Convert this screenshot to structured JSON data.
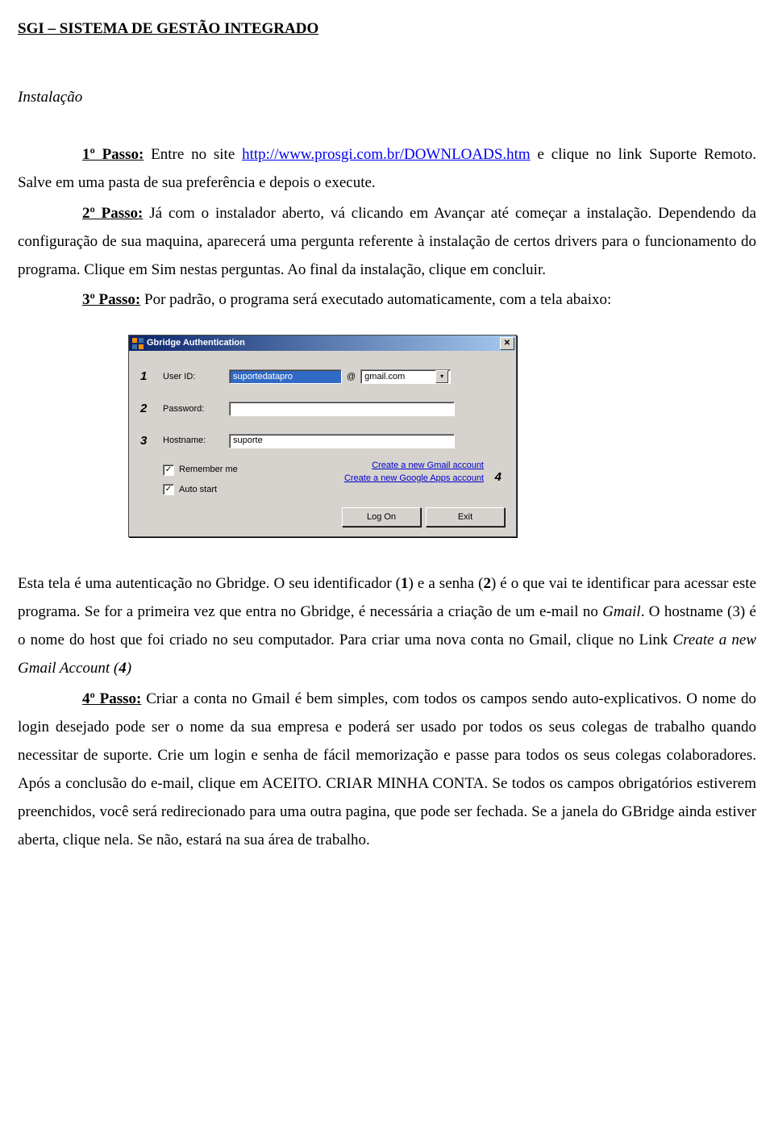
{
  "header": "SGI – SISTEMA DE GESTÃO INTEGRADO",
  "section": "Instalação",
  "step1": {
    "label": "1º Passo:",
    "text_before_link": " Entre no site ",
    "url": "http://www.prosgi.com.br/DOWNLOADS.htm",
    "text_after_link": " e clique no link Suporte Remoto. Salve em uma pasta de sua preferência e depois o execute."
  },
  "step2": {
    "label": "2º Passo:",
    "text": " Já com o instalador aberto, vá clicando em Avançar até começar a instalação. Dependendo da configuração de sua maquina, aparecerá uma pergunta referente à instalação de certos drivers para o funcionamento do programa. Clique em Sim nestas perguntas. Ao final da instalação, clique em concluir."
  },
  "step3": {
    "label": "3º Passo:",
    "text": " Por padrão, o programa será executado automaticamente, com a tela abaixo:"
  },
  "dialog": {
    "title": "Gbridge Authentication",
    "rows": {
      "userid": {
        "num": "1",
        "label": "User ID:",
        "value": "suportedatapro",
        "at": "@",
        "domain": "gmail.com"
      },
      "password": {
        "num": "2",
        "label": "Password:",
        "value": ""
      },
      "hostname": {
        "num": "3",
        "label": "Hostname:",
        "value": "suporte"
      }
    },
    "checks": {
      "remember": "Remember me",
      "autostart": "Auto start"
    },
    "links": {
      "gmail": "Create a new Gmail account",
      "apps": "Create a new Google Apps account",
      "num": "4"
    },
    "buttons": {
      "logon": "Log On",
      "exit": "Exit"
    },
    "close_glyph": "✕",
    "check_glyph": "✓",
    "dd_glyph": "▾"
  },
  "body2": {
    "p1a": "Esta tela é uma autenticação no Gbridge. O seu identificador (",
    "n1": "1",
    "p1b": ") e a senha (",
    "n2": "2",
    "p1c": ") é o que vai te identificar para acessar este programa. Se for a primeira vez que entra no Gbridge, é necessária a criação de um e-mail no ",
    "gmail": "Gmail",
    "p1d": ". O hostname (3) é o nome do host que foi criado no seu computador. Para criar uma nova conta no Gmail, clique no Link ",
    "link_text": "Create a new Gmail Account",
    "p1e": " (",
    "n4": "4",
    "p1f": ")"
  },
  "step4": {
    "label": "4º Passo:",
    "text": " Criar a conta no Gmail é bem simples, com todos os campos sendo auto-explicativos. O nome do login desejado pode ser o nome da sua empresa e poderá ser usado por todos os seus colegas de trabalho quando necessitar de suporte. Crie um login e senha de fácil memorização e passe para todos os seus colegas colaboradores. Após a conclusão do e-mail, clique em ACEITO. CRIAR MINHA CONTA. Se todos os campos obrigatórios estiverem preenchidos, você será redirecionado para uma outra pagina, que pode ser fechada. Se a janela do GBridge ainda estiver aberta, clique nela. Se não, estará na sua área de trabalho."
  }
}
